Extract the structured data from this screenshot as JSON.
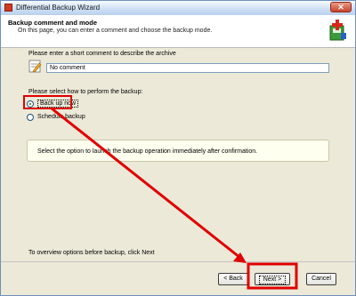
{
  "window": {
    "title": "Differential Backup Wizard",
    "close_symbol": "✕"
  },
  "header": {
    "title": "Backup comment and mode",
    "subtitle": "On this page, you can enter a comment and choose the backup mode."
  },
  "comment": {
    "label": "Please enter a short comment to describe the archive",
    "value": "No comment"
  },
  "mode": {
    "label": "Please select how to perform the backup:",
    "options": [
      {
        "label": "Back up now",
        "selected": true
      },
      {
        "label": "Schedule backup",
        "selected": false
      }
    ],
    "description": "Select the option to launch the backup operation immediately after confirmation."
  },
  "overview": "To overview options before backup, click Next",
  "buttons": {
    "back": "< Back",
    "next": "Next >",
    "cancel": "Cancel"
  },
  "colors": {
    "annotation": "#e00000",
    "window_border": "#6f8fbf",
    "titlebar": "#cfe0f5"
  }
}
